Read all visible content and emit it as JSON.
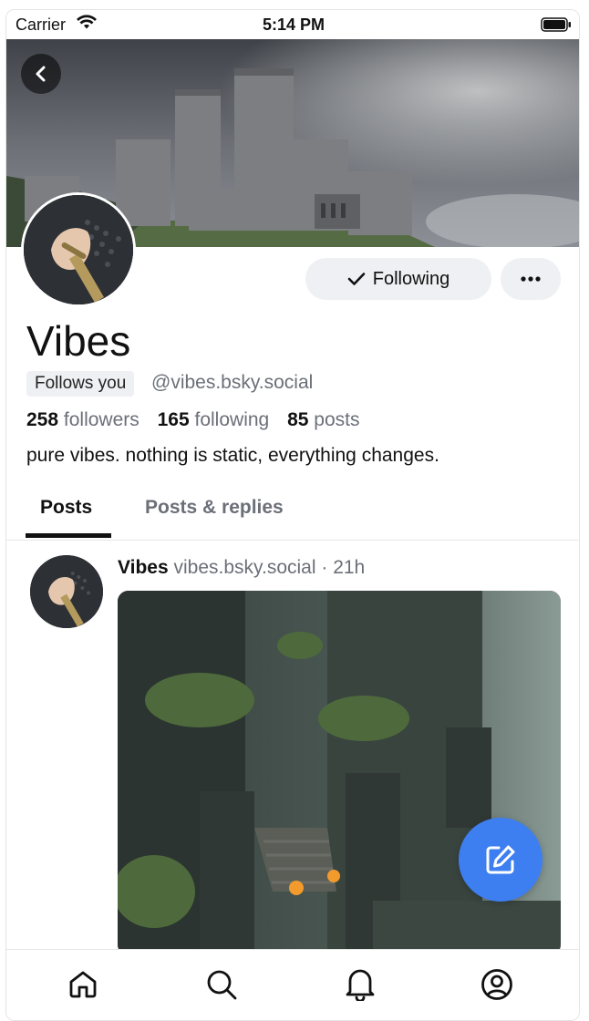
{
  "status_bar": {
    "carrier": "Carrier",
    "time": "5:14 PM",
    "icons": [
      "wifi-icon",
      "battery-icon"
    ]
  },
  "header": {
    "back_icon": "chevron-left-icon",
    "banner_image": "castle-banner",
    "avatar_image": "armored-fist-avatar"
  },
  "actions": {
    "following_label": "Following",
    "following_icon": "check-icon",
    "more_icon": "ellipsis-icon"
  },
  "profile": {
    "display_name": "Vibes",
    "follows_you": "Follows you",
    "handle": "@vibes.bsky.social",
    "followers_count": "258",
    "followers_label": "followers",
    "following_count": "165",
    "following_label": "following",
    "posts_count": "85",
    "posts_label": "posts",
    "bio": "pure vibes. nothing is static, everything changes."
  },
  "tabs": [
    {
      "label": "Posts",
      "active": true
    },
    {
      "label": "Posts & replies",
      "active": false
    }
  ],
  "post": {
    "author": "Vibes",
    "handle": "vibes.bsky.social",
    "separator": "·",
    "time": "21h",
    "image": "ruined-temple-image"
  },
  "fab_icon": "compose-icon",
  "bottom_nav": [
    {
      "icon": "home-icon"
    },
    {
      "icon": "search-icon"
    },
    {
      "icon": "notifications-icon"
    },
    {
      "icon": "profile-icon"
    }
  ],
  "colors": {
    "accent": "#3d7ff0",
    "pill_bg": "#eef0f3",
    "muted_text": "#6b6f78"
  }
}
